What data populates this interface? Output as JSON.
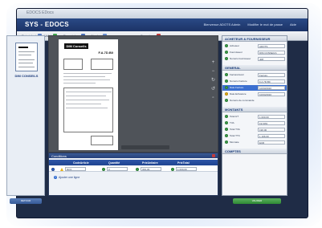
{
  "window": {
    "title": "EDOCS EDocs"
  },
  "app": {
    "title": "SYS - EDOCS",
    "header_links": [
      "Bienvenue ADOTS Admin",
      "Modifier le mot de passe",
      "Aide"
    ]
  },
  "toolbar": {
    "items": [
      {
        "label": "Précédent",
        "icon": "arrow-left-icon"
      },
      {
        "label": "Valid",
        "icon": "check-icon"
      },
      {
        "label": "Enregistrer",
        "icon": "save-icon"
      },
      {
        "label": "Ajouter",
        "icon": "add-icon"
      },
      {
        "label": "Supprimer",
        "icon": "close-icon"
      }
    ]
  },
  "thumbnails": {
    "label": "DIM CONSEILS"
  },
  "left_button": {
    "label": "RETOUR"
  },
  "document": {
    "logo": "DIM Conseils",
    "invoice_number": "F.A.7D.B0"
  },
  "panel": {
    "sections": {
      "fournisseur": "ACHETEUR & FOURNISSEUR",
      "general": "GENERAL",
      "montants": "MONTANTS",
      "comptes": "COMPTES"
    },
    "fournisseur_rows": [
      {
        "label": "Acheteur",
        "value": "ADOTS"
      },
      {
        "label": "Fournisseur",
        "value": "DIM CONSEILS"
      },
      {
        "label": "Numéro fournisseur",
        "value": "408"
      }
    ],
    "general_rows": [
      {
        "label": "Facture/Avoir",
        "value": "Facture"
      },
      {
        "label": "Numéro Facture",
        "value": "F.A.7D.B0"
      },
      {
        "label": "Date Facture",
        "value": "10/03/2010"
      },
      {
        "label": "Date Echéance",
        "value": "10/04/2010"
      },
      {
        "label": "Numéro de commande",
        "value": ""
      }
    ],
    "montants_rows": [
      {
        "label": "Total HT",
        "value": "1 000,00"
      },
      {
        "label": "TVA",
        "value": "19,60%"
      },
      {
        "label": "Total TVA",
        "value": "196,00"
      },
      {
        "label": "Total TTC",
        "value": "1 196,00"
      },
      {
        "label": "Monnaie",
        "value": "EUR"
      }
    ]
  },
  "right_button": {
    "label": "VALIDER"
  },
  "grid": {
    "title": "Conditions",
    "columns": [
      "CodeArticle",
      "Quantité",
      "PrixUnitaire",
      "PrixTotal"
    ],
    "row": [
      "NO1",
      "3",
      "333,33",
      "1 000,00"
    ],
    "add_label": "Ajouter une ligne"
  },
  "colors": {
    "accent": "#1f4390",
    "ok": "#3fa34d",
    "warn": "#e7b21a"
  }
}
